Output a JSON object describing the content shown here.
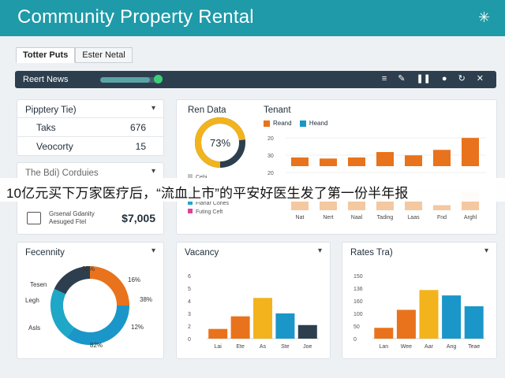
{
  "header": {
    "title": "Community Property Rental",
    "menu_icon": "✳"
  },
  "tabs": [
    {
      "label": "Totter Puts"
    },
    {
      "label": "Ester Netal"
    }
  ],
  "news": {
    "label": "Reert News",
    "progress_fraction": 0.85
  },
  "property": {
    "title": "Pipptery Tie)",
    "rows": [
      {
        "label": "Taks",
        "value": "676"
      },
      {
        "label": "Veocorty",
        "value": "15"
      }
    ]
  },
  "schedules": {
    "title": "The Bdi) Corduies",
    "line1": "Grsenal Gdanity",
    "line2": "Aesuged Ftel",
    "amount": "$7,005"
  },
  "rent": {
    "title": "Ren Data",
    "percent": "73%",
    "fraction": 0.73,
    "legend": [
      "Cehi",
      "Ind Ceri",
      "Fanci Coleeti",
      "Fianar Cories",
      "Futing Ceft"
    ],
    "legend_colors": [
      "#bfc6cc",
      "#bfc6cc",
      "#5b8fa8",
      "#1ea7c7",
      "#e0409a"
    ]
  },
  "tenant": {
    "title": "Tenant",
    "legend": [
      "Reand",
      "Heand"
    ],
    "colors": {
      "primary": "#e8731c",
      "secondary": "#1a97c8",
      "muted": "#f4c8a0"
    },
    "y_ticks": [
      "20",
      "30",
      "20",
      "10"
    ],
    "x_labels": [
      "Nat",
      "Nert",
      "Naal",
      "Tading",
      "Laas",
      "Fnd",
      "Arghl"
    ]
  },
  "banner": {
    "text": "10亿元买下万家医疗后，“流血上市”的平安好医生发了第一份半年报"
  },
  "fecennity": {
    "title": "Fecennity",
    "labels_left": [
      "Tesen",
      "Legh",
      "Asls"
    ],
    "labels_right": [
      "16%",
      "38%",
      "12%"
    ],
    "label_top": "35%",
    "label_bottom": "82%"
  },
  "vacancy": {
    "title": "Vacancy",
    "y_ticks": [
      "6",
      "5",
      "4",
      "3",
      "2",
      "0"
    ],
    "x_labels": [
      "Lai",
      "Ete",
      "As",
      "Ste",
      "Joe"
    ]
  },
  "rates": {
    "title": "Rates Tra)",
    "y_ticks": [
      "150",
      "136",
      "160",
      "100",
      "50",
      "0"
    ],
    "x_labels": [
      "Lan",
      "Wee",
      "Aar",
      "Ang",
      "Teae"
    ]
  },
  "chart_data": [
    {
      "type": "pie",
      "title": "Ren Data",
      "slices": [
        {
          "label": "",
          "value": 73
        },
        {
          "label": "",
          "value": 27
        }
      ],
      "center_label": "73%"
    },
    {
      "type": "bar",
      "title": "Tenant",
      "categories": [
        "Nat",
        "Nert",
        "Naal",
        "Tading",
        "Laas",
        "Fnd",
        "Arghl"
      ],
      "series": [
        {
          "name": "Reand",
          "values": [
            8,
            7,
            8,
            13,
            10,
            15,
            26
          ]
        },
        {
          "name": "Heand",
          "values": [
            10,
            7,
            4,
            6,
            4,
            2,
            7
          ]
        }
      ],
      "ylim": [
        0,
        40
      ]
    },
    {
      "type": "pie",
      "title": "Fecennity",
      "slices": [
        {
          "label": "16%",
          "value": 25
        },
        {
          "label": "38%",
          "value": 35
        },
        {
          "label": "12%",
          "value": 22
        },
        {
          "label": "",
          "value": 18
        }
      ],
      "colors": [
        "#e8731c",
        "#1a97c8",
        "#1ea7c7",
        "#2d3f4e"
      ]
    },
    {
      "type": "bar",
      "title": "Vacancy",
      "categories": [
        "Lai",
        "Ete",
        "As",
        "Ste",
        "Joe"
      ],
      "values": [
        1.0,
        2.3,
        4.2,
        2.6,
        1.4
      ],
      "colors": [
        "#e8731c",
        "#e8731c",
        "#f2b31d",
        "#1a97c8",
        "#2d3f4e"
      ],
      "ylim": [
        0,
        6.5
      ]
    },
    {
      "type": "bar",
      "title": "Rates Tra)",
      "categories": [
        "Lan",
        "Wee",
        "Aar",
        "Ang",
        "Teae"
      ],
      "values": [
        30,
        80,
        135,
        120,
        90
      ],
      "colors": [
        "#e8731c",
        "#e8731c",
        "#f2b31d",
        "#1a97c8",
        "#1a97c8"
      ],
      "ylim": [
        0,
        175
      ]
    }
  ]
}
